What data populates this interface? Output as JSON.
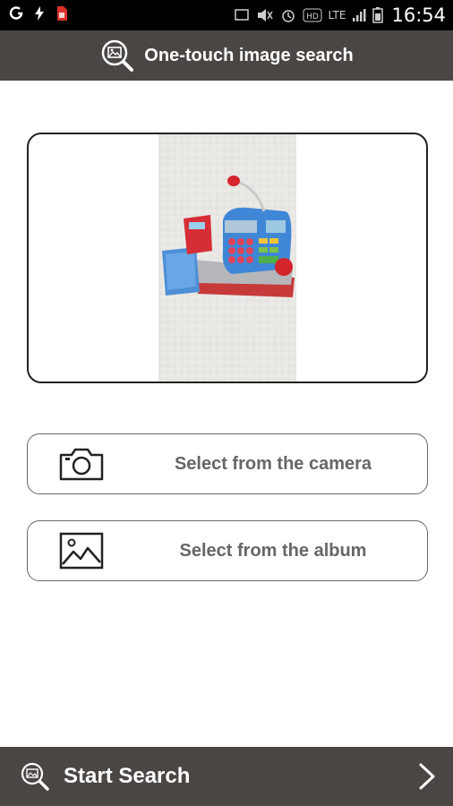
{
  "status_bar": {
    "time": "16:54",
    "network": "LTE"
  },
  "header": {
    "title": "One-touch image search",
    "icon": "image-search-icon"
  },
  "preview": {
    "icon": "toy-cash-register-photo"
  },
  "actions": [
    {
      "label": "Select from the camera",
      "icon": "camera-icon"
    },
    {
      "label": "Select from the album",
      "icon": "image-icon"
    }
  ],
  "footer": {
    "label": "Start Search",
    "icon": "image-search-icon",
    "chevron_icon": "chevron-right-icon"
  },
  "colors": {
    "bar_bg": "#4a4644",
    "button_text": "#666666",
    "border": "#222222"
  }
}
